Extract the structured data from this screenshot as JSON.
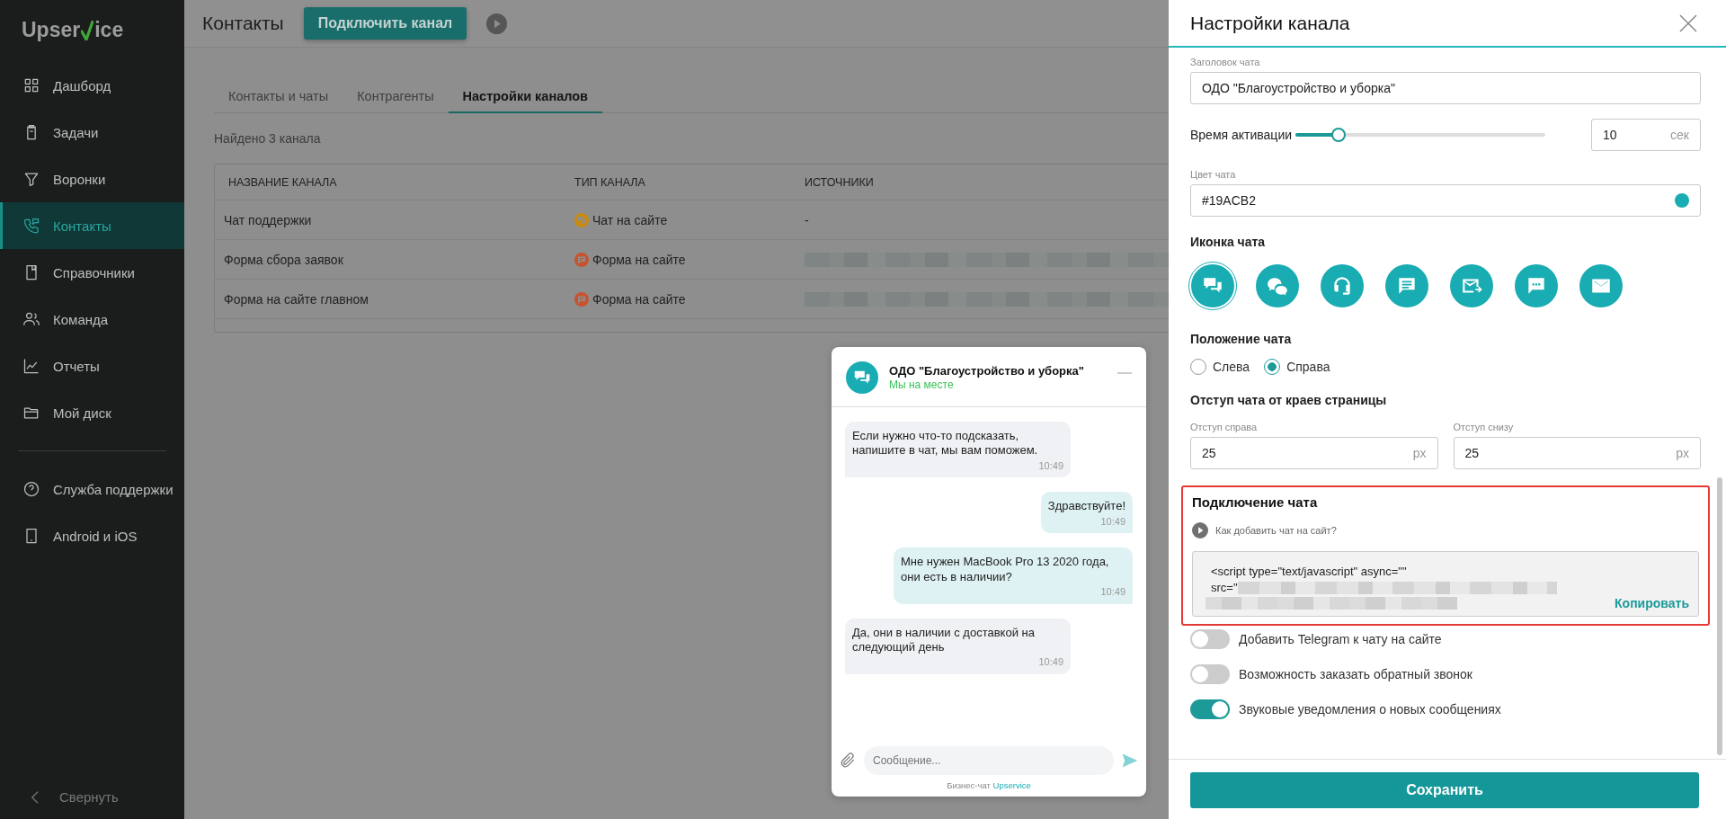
{
  "sidebar": {
    "logo": {
      "before": "Upser",
      "after": "ice"
    },
    "items": [
      {
        "label": "Дашборд",
        "kind": "grid",
        "selected": false
      },
      {
        "label": "Задачи",
        "kind": "clipboard",
        "selected": false
      },
      {
        "label": "Воронки",
        "kind": "funnel",
        "selected": false
      },
      {
        "label": "Контакты",
        "kind": "phone",
        "selected": true
      },
      {
        "label": "Справочники",
        "kind": "book",
        "selected": false
      },
      {
        "label": "Команда",
        "kind": "people",
        "selected": false
      },
      {
        "label": "Отчеты",
        "kind": "chart",
        "selected": false
      },
      {
        "label": "Мой диск",
        "kind": "folder",
        "selected": false
      }
    ],
    "bottom_items": [
      {
        "label": "Служба поддержки",
        "kind": "help",
        "selected": false
      },
      {
        "label": "Android и iOS",
        "kind": "tablet",
        "selected": false
      }
    ],
    "collapse": "Свернуть"
  },
  "header": {
    "title": "Контакты",
    "connect_button": "Подключить канал"
  },
  "tabs": [
    {
      "label": "Контакты и чаты",
      "selected": false
    },
    {
      "label": "Контрагенты",
      "selected": false
    },
    {
      "label": "Настройки каналов",
      "selected": true
    }
  ],
  "found": "Найдено 3 канала",
  "table": {
    "columns": [
      "НАЗВАНИЕ КАНАЛА",
      "ТИП КАНАЛА",
      "ИСТОЧНИКИ"
    ],
    "rows": [
      {
        "name": "Чат поддержки",
        "type": {
          "kind": "chat",
          "label": "Чат на сайте"
        },
        "source": "-",
        "redacted": false
      },
      {
        "name": "Форма сбора заявок",
        "type": {
          "kind": "form",
          "label": "Форма на сайте"
        },
        "redacted": true
      },
      {
        "name": "Форма на сайте главном",
        "type": {
          "kind": "form",
          "label": "Форма на сайте"
        },
        "redacted": true
      }
    ]
  },
  "chat_preview": {
    "title": "ОДО \"Благоустройство и уборка\"",
    "status": "Мы на месте",
    "messages": [
      {
        "kind": "incoming",
        "text": "Если нужно что-то подсказать, напишите в чат, мы вам поможем.",
        "time": "10:49"
      },
      {
        "kind": "outgoing",
        "text": "Здравствуйте!",
        "time": "10:49"
      },
      {
        "kind": "outgoing",
        "text": "Мне нужен MacBook Pro 13 2020 года, они есть в наличии?",
        "time": "10:49"
      },
      {
        "kind": "incoming",
        "text": "Да, они в наличии с доставкой на следующий день",
        "time": "10:49"
      }
    ],
    "input_placeholder": "Сообщение...",
    "footer": "Бизнес-чат",
    "footer_link": "Upservice"
  },
  "panel": {
    "title": "Настройки канала",
    "chat_title": {
      "label": "Заголовок чата",
      "value": "ОДО \"Благоустройство и уборка\""
    },
    "activation": {
      "label": "Время активации",
      "level": 0.17,
      "value": "10",
      "unit": "сек"
    },
    "chat_color": {
      "label": "Цвет чата",
      "value": "#19ACB2",
      "color": "#19acb2"
    },
    "icon_section": {
      "label": "Иконка чата",
      "icons": [
        {
          "kind": "bubbles",
          "selected": true
        },
        {
          "kind": "faces",
          "selected": false
        },
        {
          "kind": "headset",
          "selected": false
        },
        {
          "kind": "message",
          "selected": false
        },
        {
          "kind": "mail-arrow",
          "selected": false
        },
        {
          "kind": "dots",
          "selected": false
        },
        {
          "kind": "mail",
          "selected": false
        }
      ]
    },
    "position": {
      "label": "Положение чата",
      "options": [
        {
          "label": "Слева",
          "selected": false
        },
        {
          "label": "Справа",
          "selected": true
        }
      ]
    },
    "offsets": {
      "heading": "Отступ чата от краев страницы",
      "fields": [
        {
          "label": "Отступ справа",
          "value": "25",
          "unit": "px"
        },
        {
          "label": "Отступ снизу",
          "value": "25",
          "unit": "px"
        }
      ]
    },
    "connect": {
      "heading": "Подключение чата",
      "highlighted": true,
      "help": "Как добавить чат на сайт?",
      "code_line": "<script type=\"text/javascript\" async=\"\"",
      "code_src": "src=\"",
      "copy": "Копировать"
    },
    "toggles": [
      {
        "label": "Добавить Telegram к чату на сайте",
        "on": false
      },
      {
        "label": "Возможность заказать обратный звонок",
        "on": false
      },
      {
        "label": "Звуковые уведомления о новых сообщениях",
        "on": true
      }
    ],
    "save_button": "Сохранить"
  }
}
